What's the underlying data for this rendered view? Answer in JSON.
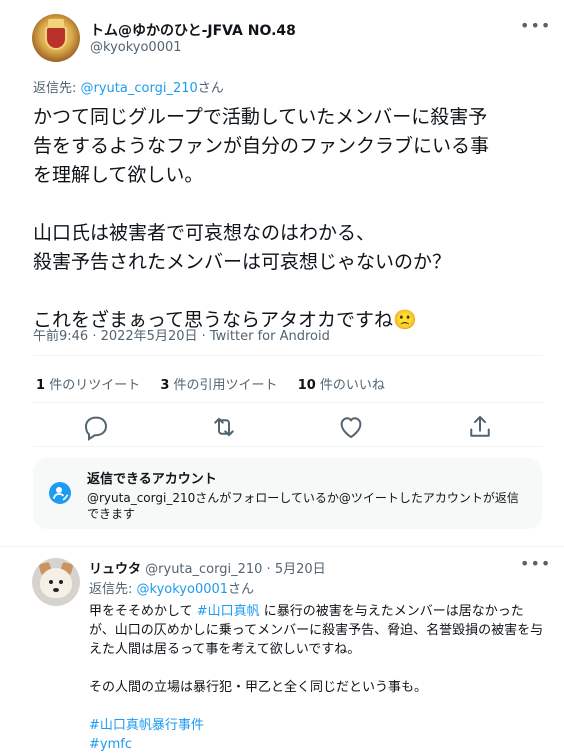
{
  "tweet": {
    "author_name": "トム@ゆかのひと-JFVA NO.48",
    "author_handle": "@kyokyo0001",
    "reply_label": "返信先: ",
    "reply_handle": "@ryuta_corgi_210",
    "reply_suffix": "さん",
    "text": "かつて同じグループで活動していたメンバーに殺害予\n告をするようなファンが自分のファンクラブにいる事\nを理解して欲しい。\n\n山口氏は被害者で可哀想なのはわかる、\n殺害予告されたメンバーは可哀想じゃないのか？\n\nこれをざまぁって思うならアタオカですね🙁",
    "timestamp": "午前9:46 · 2022年5月20日 · Twitter for Android",
    "stats": [
      {
        "count": "1",
        "label": "件のリツイート"
      },
      {
        "count": "3",
        "label": "件の引用ツイート"
      },
      {
        "count": "10",
        "label": "件のいいね"
      }
    ],
    "icons": [
      "reply-icon",
      "retweet-icon",
      "like-icon",
      "share-icon"
    ]
  },
  "reply_card": {
    "title": "返信できるアカウント",
    "description": "@ryuta_corgi_210さんがフォローしているか@ツイートしたアカウントが返信できます"
  },
  "reply_tweet": {
    "author_name": "リュウタ",
    "author_handle": "@ryuta_corgi_210",
    "separator": " · ",
    "date": "5月20日",
    "reply_label": "返信先: ",
    "reply_handle": "@kyokyo0001",
    "reply_suffix": "さん",
    "body_part1": "甲をそそめかして ",
    "hashtag_inline": "#山口真帆",
    "body_part2": " に暴行の被害を与えたメンバーは居なかったが、山口の仄めかしに乗ってメンバーに殺害予告、脅迫、名誉毀損の被害を与えた人間は居るって事を考えて欲しいですね。",
    "paragraph2": "その人間の立場は暴行犯・甲乙と全く同じだという事も。",
    "hashtags": [
      "#山口真帆暴行事件",
      "#ymfc"
    ]
  },
  "colors": {
    "accent": "#1d9bf0",
    "text_primary": "#0f1419",
    "text_secondary": "#536471",
    "card_bg": "#f7f9f9"
  }
}
